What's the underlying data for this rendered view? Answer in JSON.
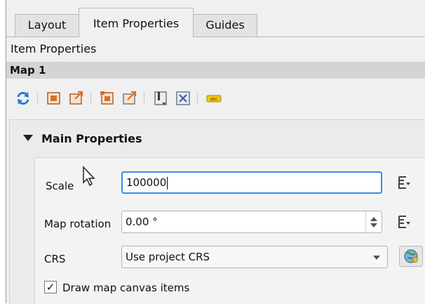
{
  "tabs": [
    {
      "label": "Layout",
      "active": false
    },
    {
      "label": "Item Properties",
      "active": true
    },
    {
      "label": "Guides",
      "active": false
    }
  ],
  "panel_title": "Item Properties",
  "item_name": "Map 1",
  "toolbar": {
    "icons": [
      "refresh-icon",
      "set-extent-from-canvas-icon",
      "view-extent-in-canvas-icon",
      "set-extent-to-canvas-icon",
      "view-map-extent-icon",
      "bookmark-icon",
      "zoom-atlas-icon",
      "label-settings-icon"
    ]
  },
  "main_properties": {
    "header": "Main Properties",
    "scale_label": "Scale",
    "scale_value": "100000",
    "rotation_label": "Map rotation",
    "rotation_value": "0.00 °",
    "crs_label": "CRS",
    "crs_value": "Use project CRS",
    "draw_canvas_label": "Draw map canvas items",
    "draw_canvas_checked": true
  },
  "colors": {
    "accent": "#3a8ee6",
    "refresh": "#2a7bd4",
    "icon_orange": "#d9702a"
  }
}
